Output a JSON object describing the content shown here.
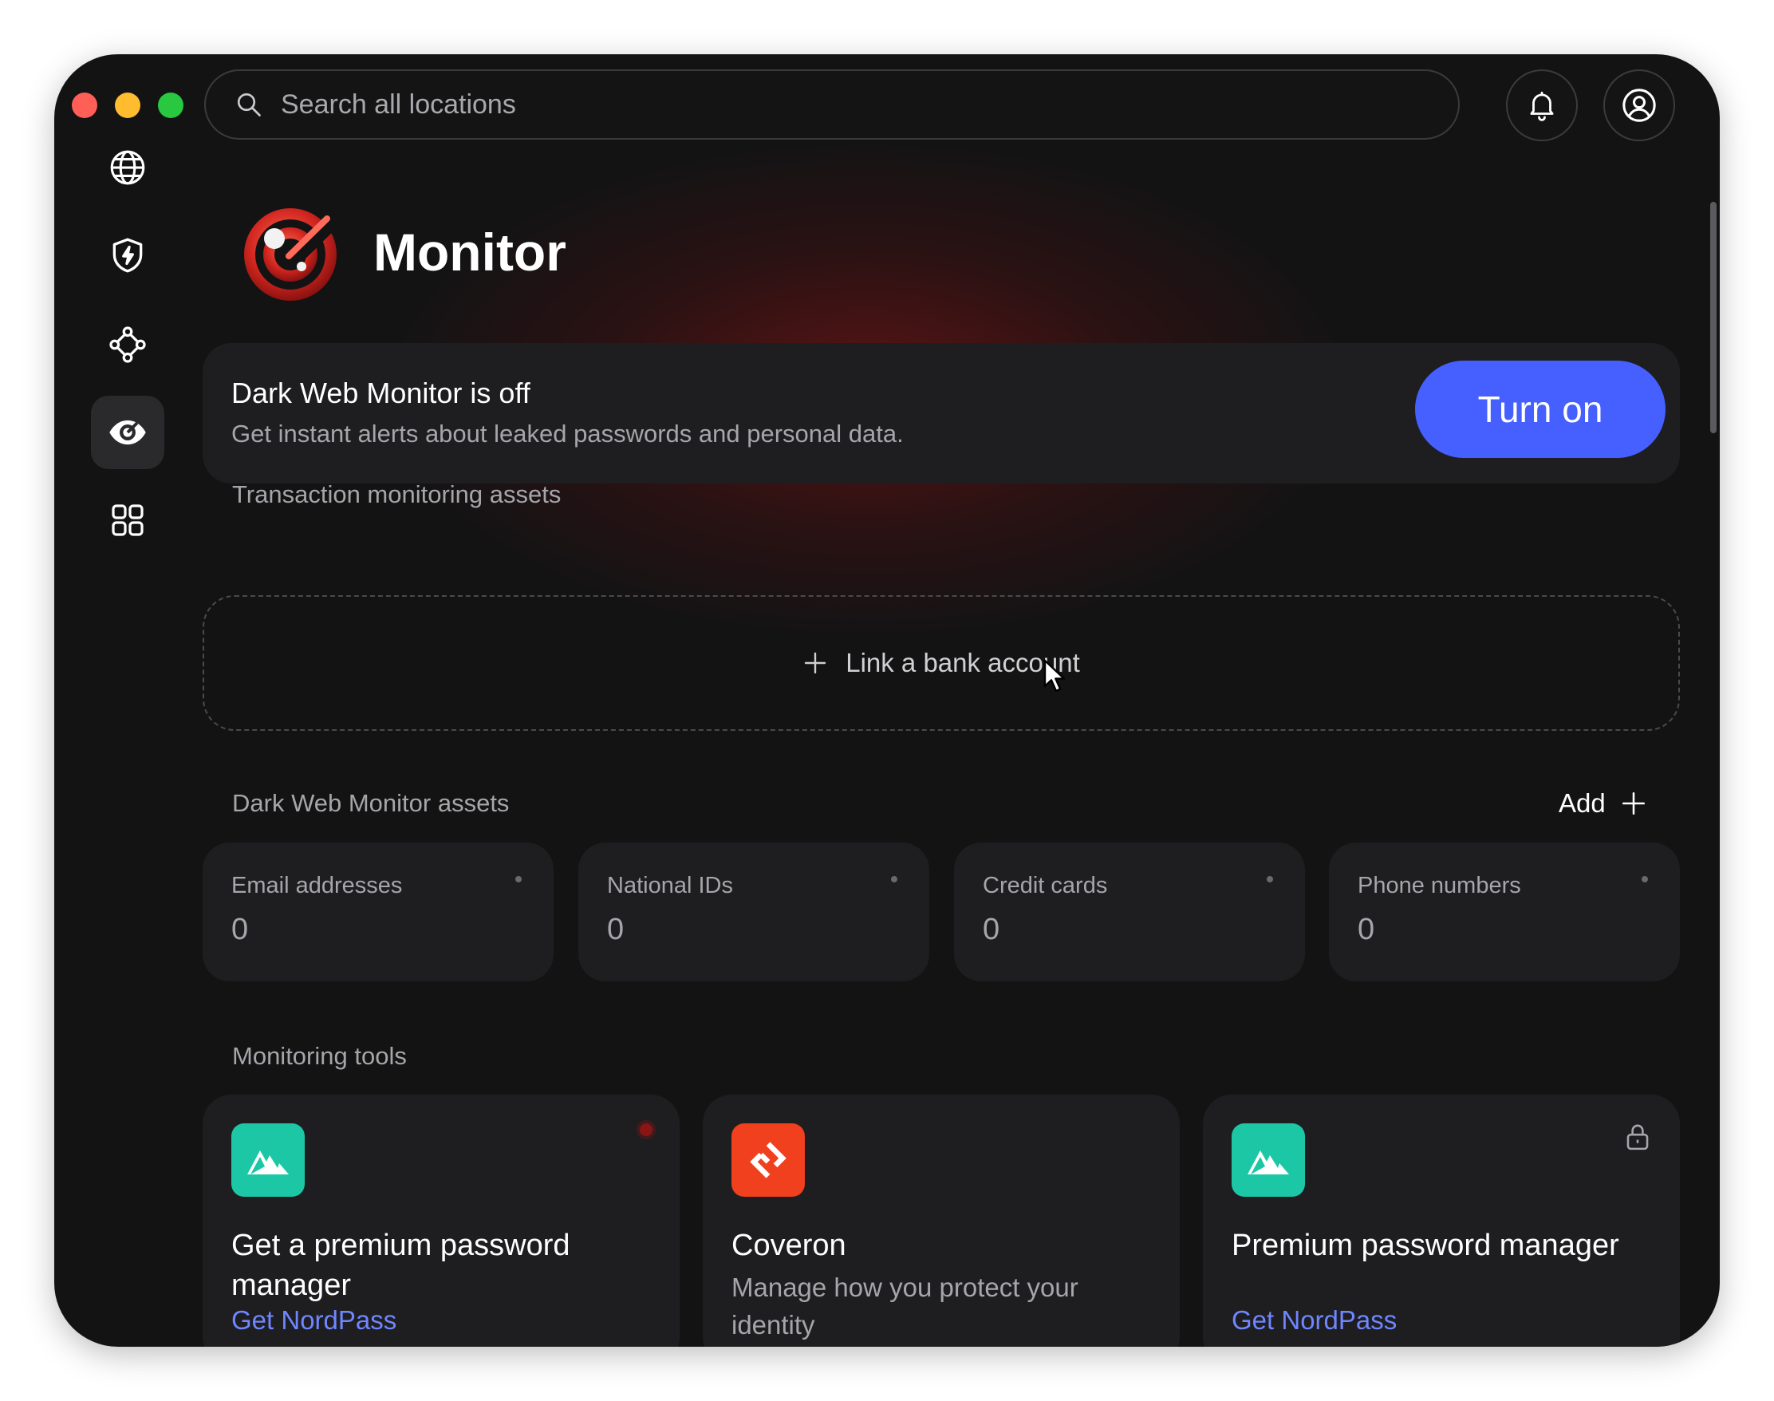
{
  "window": {
    "controls": [
      "close",
      "minimize",
      "maximize"
    ]
  },
  "search": {
    "placeholder": "Search all locations",
    "icon": "search-icon"
  },
  "header_actions": [
    {
      "name": "notifications",
      "icon": "bell-icon"
    },
    {
      "name": "profile",
      "icon": "user-circle-icon"
    }
  ],
  "sidebar": {
    "items": [
      {
        "name": "vpn",
        "icon": "globe-icon",
        "active": false
      },
      {
        "name": "threat-protection",
        "icon": "shield-bolt-icon",
        "active": false
      },
      {
        "name": "meshnet",
        "icon": "network-nodes-icon",
        "active": false
      },
      {
        "name": "monitor",
        "icon": "eye-target-icon",
        "active": true
      },
      {
        "name": "apps",
        "icon": "grid-icon",
        "active": false
      }
    ]
  },
  "page": {
    "title": "Monitor",
    "logo_icon": "monitor-radar-icon"
  },
  "banner": {
    "title": "Dark Web Monitor is off",
    "subtitle": "Get instant alerts about leaked passwords and personal data.",
    "button_label": "Turn on",
    "button_color": "#4660ff"
  },
  "transaction": {
    "label": "Transaction monitoring assets",
    "link_label": "Link a bank account"
  },
  "dark_web": {
    "label": "Dark Web Monitor assets",
    "add_label": "Add",
    "assets": [
      {
        "label": "Email addresses",
        "value": "0"
      },
      {
        "label": "National IDs",
        "value": "0"
      },
      {
        "label": "Credit cards",
        "value": "0"
      },
      {
        "label": "Phone numbers",
        "value": "0"
      }
    ]
  },
  "tools": {
    "label": "Monitoring tools",
    "items": [
      {
        "title": "Get a premium password manager",
        "link": "Get NordPass",
        "icon": "nordpass-icon",
        "icon_color": "#1cc7a6",
        "badge": "red-dot"
      },
      {
        "title": "Coveron",
        "description": "Manage how you protect your identity",
        "icon": "coveron-icon",
        "icon_color": "#f0401e"
      },
      {
        "title": "Premium password manager",
        "link": "Get NordPass",
        "icon": "nordpass-icon",
        "icon_color": "#1cc7a6",
        "badge": "lock-icon"
      }
    ]
  },
  "colors": {
    "background": "#131314",
    "card": "#1e1e20",
    "accent": "#4660ff",
    "link": "#6f86ff",
    "glow": "#8a1515"
  }
}
